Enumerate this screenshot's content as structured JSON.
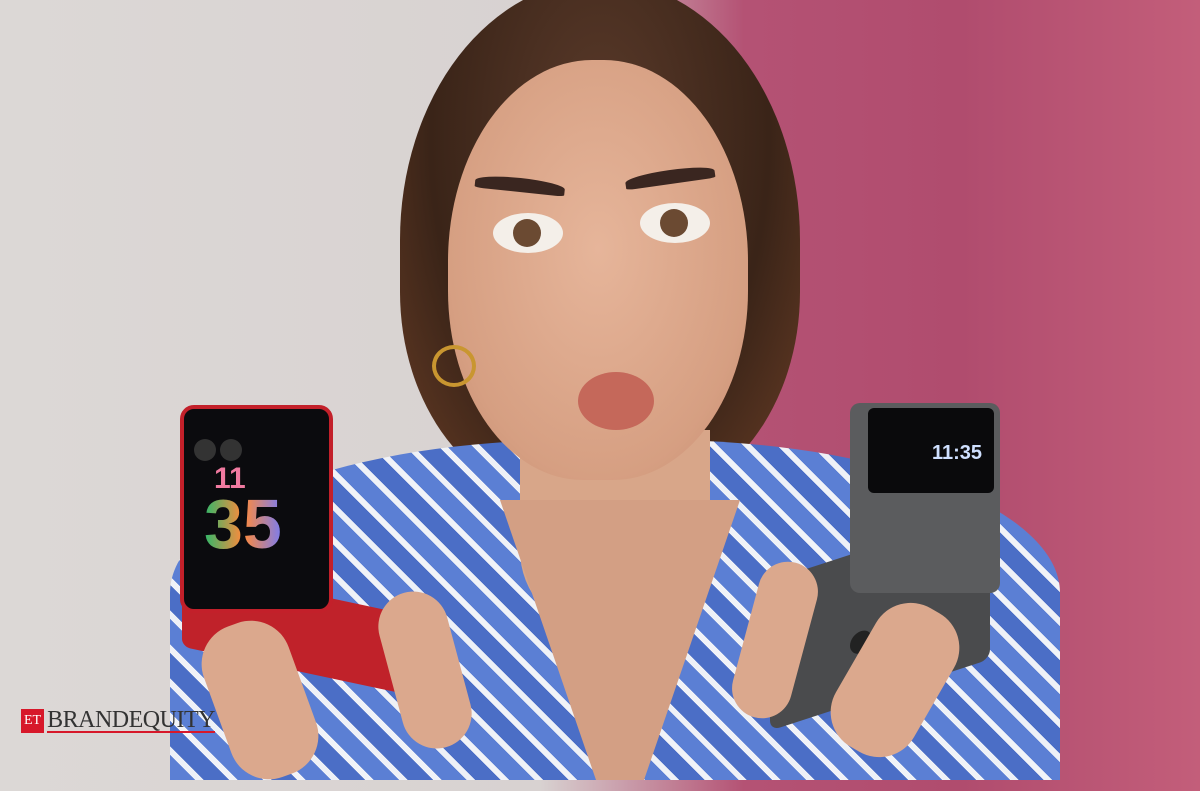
{
  "image": {
    "description_alt": "Woman holding two flip phones"
  },
  "phones": {
    "red": {
      "clock_hour": "11",
      "clock_minute": "35"
    },
    "gray": {
      "clock": "11:35"
    }
  },
  "logo": {
    "et": "ET",
    "brand": "BRANDEQUITY"
  },
  "colors": {
    "bg_left": "#dcd8d6",
    "bg_right": "#b04c6e",
    "logo_red": "#d7182a",
    "shirt_blue": "#5b7fd4"
  }
}
